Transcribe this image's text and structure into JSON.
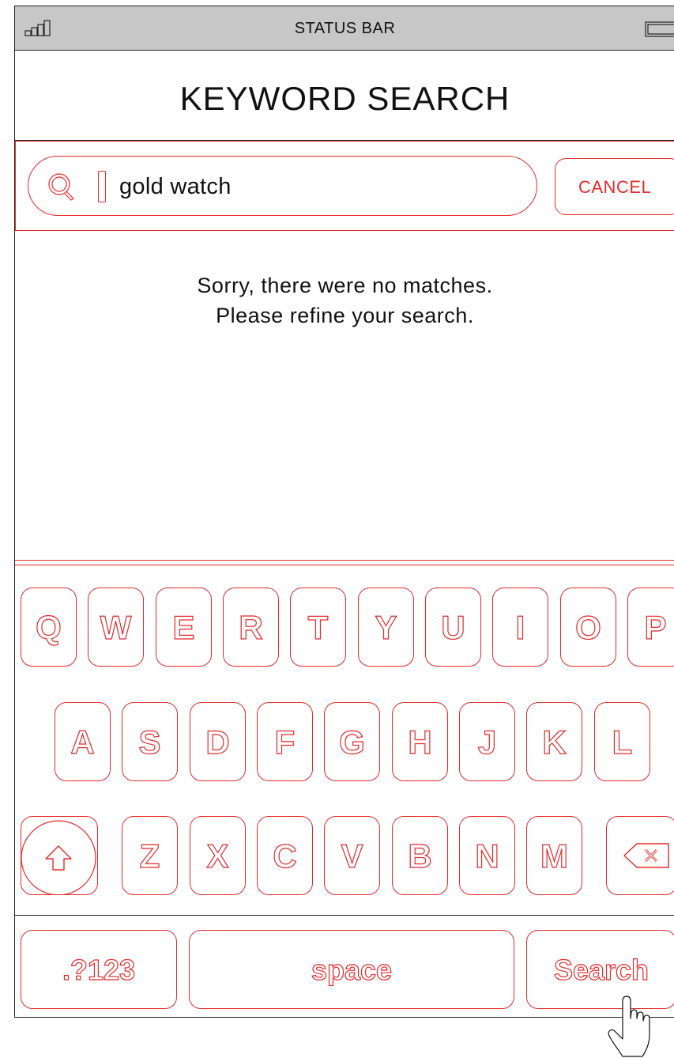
{
  "status_bar": {
    "label": "STATUS BAR"
  },
  "header": {
    "title": "KEYWORD SEARCH"
  },
  "search": {
    "value": "gold watch",
    "cancel_label": "CANCEL"
  },
  "results": {
    "message_line1": "Sorry, there were no matches.",
    "message_line2": "Please refine your search."
  },
  "keyboard": {
    "row1": [
      "Q",
      "W",
      "E",
      "R",
      "T",
      "Y",
      "U",
      "I",
      "O",
      "P"
    ],
    "row2": [
      "A",
      "S",
      "D",
      "F",
      "G",
      "H",
      "J",
      "K",
      "L"
    ],
    "row3": [
      "Z",
      "X",
      "C",
      "V",
      "B",
      "N",
      "M"
    ],
    "numbers_label": ".?123",
    "space_label": "space",
    "search_label": "Search"
  },
  "colors": {
    "accent": "#e52b2b",
    "status_bar_bg": "#c7c7c7",
    "text": "#111111"
  },
  "icons": [
    "signal-icon",
    "battery-icon",
    "search-icon",
    "shift-icon",
    "backspace-icon",
    "hand-cursor-icon"
  ]
}
